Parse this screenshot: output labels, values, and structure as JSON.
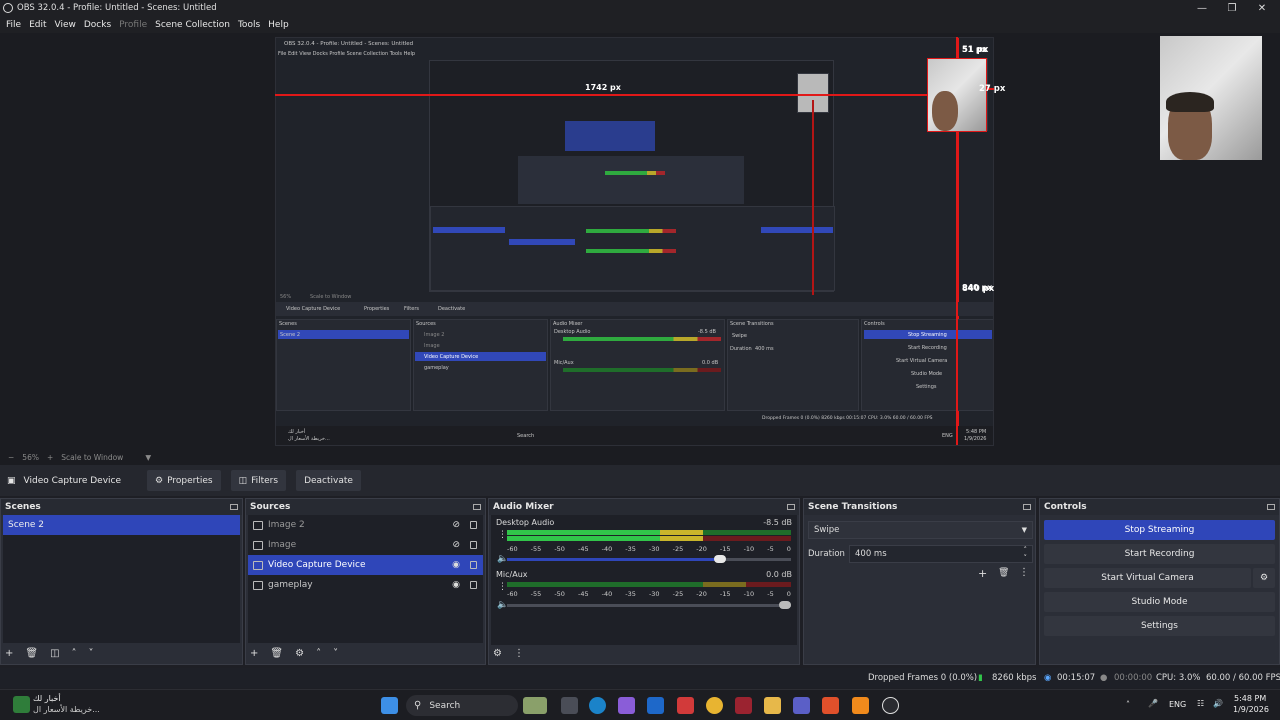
{
  "window": {
    "title": "OBS 32.0.4 - Profile: Untitled - Scenes: Untitled",
    "controls": [
      "minimize",
      "maximize",
      "close"
    ]
  },
  "menu": {
    "items": [
      {
        "label": "File",
        "enabled": true
      },
      {
        "label": "Edit",
        "enabled": true
      },
      {
        "label": "View",
        "enabled": true
      },
      {
        "label": "Docks",
        "enabled": true
      },
      {
        "label": "Profile",
        "enabled": false
      },
      {
        "label": "Scene Collection",
        "enabled": true
      },
      {
        "label": "Tools",
        "enabled": true
      },
      {
        "label": "Help",
        "enabled": true
      }
    ]
  },
  "preview": {
    "labels": {
      "width_px": "1742 px",
      "top_px": "51 px",
      "right_px": "27 px",
      "bottom_px": "840 px"
    },
    "nested": {
      "title": "OBS 32.0.4 - Profile: Untitled - Scenes: Untitled",
      "menu": "File  Edit  View  Docks  Profile  Scene Collection  Tools  Help",
      "width_px": "1742 px",
      "top_px": "51 px",
      "right_px": "27 px",
      "bottom_px": "840 px",
      "zoom": "56%",
      "scale": "Scale to Window",
      "source": "Video Capture Device",
      "properties": "Properties",
      "filters": "Filters",
      "deactivate": "Deactivate",
      "scenes": "Scenes",
      "sources": "Sources",
      "audio_mixer": "Audio Mixer",
      "scene_transitions": "Scene Transitions",
      "controls": "Controls",
      "scene_item": "Scene 2",
      "src_items": [
        "Image 2",
        "Image",
        "Video Capture Device",
        "gameplay"
      ],
      "desktop_audio": "Desktop Audio",
      "mic_aux": "Mic/Aux",
      "desktop_db": "-8.5 dB",
      "mic_db": "0.0 dB",
      "swipe": "Swipe",
      "duration": "Duration",
      "duration_val": "400 ms",
      "stop_streaming": "Stop Streaming",
      "start_recording": "Start Recording",
      "start_virtual": "Start Virtual Camera",
      "studio_mode": "Studio Mode",
      "settings": "Settings",
      "status": "Dropped Frames 0 (0.0%)   8260 kbps   00:15:07   CPU: 3.0%   60.00 / 60.00 FPS",
      "search": "Search",
      "news_line1": "أخبار لك",
      "news_line2": "خريطة الأسعار ال...",
      "time": "5:48 PM",
      "date": "1/9/2026",
      "lang": "ENG"
    }
  },
  "zoombar": {
    "zoom": "56%",
    "plus": "+",
    "scale_mode": "Scale to Window"
  },
  "source_toolbar": {
    "selected_source": "Video Capture Device",
    "properties": "Properties",
    "filters": "Filters",
    "deactivate": "Deactivate"
  },
  "scenes": {
    "title": "Scenes",
    "items": [
      "Scene 2"
    ]
  },
  "sources": {
    "title": "Sources",
    "items": [
      {
        "label": "Image 2",
        "visible": false
      },
      {
        "label": "Image",
        "visible": false
      },
      {
        "label": "Video Capture Device",
        "visible": true,
        "selected": true
      },
      {
        "label": "gameplay",
        "visible": true
      }
    ]
  },
  "audio_mixer": {
    "title": "Audio Mixer",
    "ticks": [
      "-60",
      "-55",
      "-50",
      "-45",
      "-40",
      "-35",
      "-30",
      "-25",
      "-20",
      "-15",
      "-10",
      "-5",
      "0"
    ],
    "channels": [
      {
        "name": "Desktop Audio",
        "db": "-8.5 dB",
        "level": 0.64,
        "volume": 0.75
      },
      {
        "name": "Mic/Aux",
        "db": "0.0 dB",
        "level": 0.0,
        "volume": 1.0
      }
    ]
  },
  "transitions": {
    "title": "Scene Transitions",
    "selected": "Swipe",
    "duration_label": "Duration",
    "duration_value": "400 ms"
  },
  "controls": {
    "title": "Controls",
    "stop_streaming": "Stop Streaming",
    "start_recording": "Start Recording",
    "start_virtual_camera": "Start Virtual Camera",
    "studio_mode": "Studio Mode",
    "settings": "Settings"
  },
  "status": {
    "dropped_frames": "Dropped Frames 0 (0.0%)",
    "bitrate": "8260 kbps",
    "stream_time": "00:15:07",
    "record_time": "00:00:00",
    "cpu": "CPU: 3.0%",
    "fps": "60.00 / 60.00 FPS"
  },
  "taskbar": {
    "news_line1": "أخبار لك",
    "news_line2": "خريطة الأسعار ال...",
    "search": "Search",
    "lang": "ENG",
    "time": "5:48 PM",
    "date": "1/9/2026"
  },
  "colors": {
    "accent": "#2f46b9",
    "guide": "#e01818",
    "meter_green": "#31c54a",
    "meter_yellow": "#c9b52b",
    "meter_red": "#a8262b"
  }
}
